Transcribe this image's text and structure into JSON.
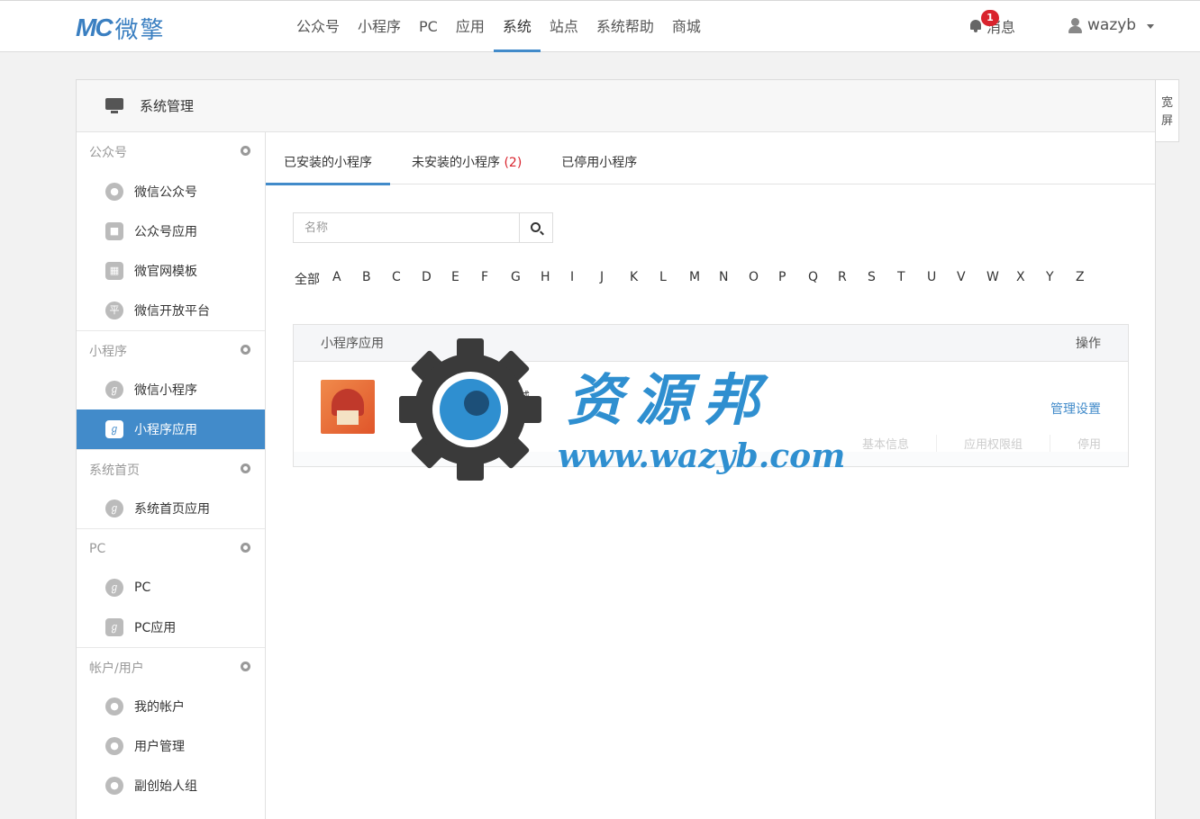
{
  "header": {
    "logo_mark": "MC",
    "logo_text": "微擎",
    "nav": [
      "公众号",
      "小程序",
      "PC",
      "应用",
      "系统",
      "站点",
      "系统帮助",
      "商城"
    ],
    "active_nav": "系统",
    "messages_label": "消息",
    "messages_count": "1",
    "username": "wazyb"
  },
  "panel": {
    "title": "系统管理",
    "widescreen_label": "宽屏"
  },
  "sidebar": {
    "groups": [
      {
        "title": "公众号",
        "items": [
          "微信公众号",
          "公众号应用",
          "微官网模板",
          "微信开放平台"
        ]
      },
      {
        "title": "小程序",
        "items": [
          "微信小程序",
          "小程序应用"
        ]
      },
      {
        "title": "系统首页",
        "items": [
          "系统首页应用"
        ]
      },
      {
        "title": "PC",
        "items": [
          "PC",
          "PC应用"
        ]
      },
      {
        "title": "帐户/用户",
        "items": [
          "我的帐户",
          "用户管理",
          "副创始人组"
        ]
      }
    ],
    "active_item": "小程序应用"
  },
  "main": {
    "tabs": [
      {
        "label": "已安装的小程序",
        "count": ""
      },
      {
        "label": "未安装的小程序",
        "count": "(2)"
      },
      {
        "label": "已停用小程序",
        "count": ""
      }
    ],
    "search_placeholder": "名称",
    "alpha_all": "全部",
    "alpha": [
      "A",
      "B",
      "C",
      "D",
      "E",
      "F",
      "G",
      "H",
      "I",
      "J",
      "K",
      "L",
      "M",
      "N",
      "O",
      "P",
      "Q",
      "R",
      "S",
      "T",
      "U",
      "V",
      "W",
      "X",
      "Y",
      "Z"
    ],
    "table": {
      "col_app": "小程序应用",
      "col_action": "操作",
      "rows": [
        {
          "name": "夫...小...序商城",
          "version": "版...6",
          "manage": "管理设置",
          "sub_actions": [
            "基本信息",
            "应用权限组",
            "停用"
          ]
        }
      ]
    }
  },
  "watermark": {
    "text": "资源邦",
    "url": "www.wazyb.com"
  },
  "colors": {
    "accent": "#428bca",
    "badge": "#d9232d",
    "watermark": "#2f8fd0"
  }
}
